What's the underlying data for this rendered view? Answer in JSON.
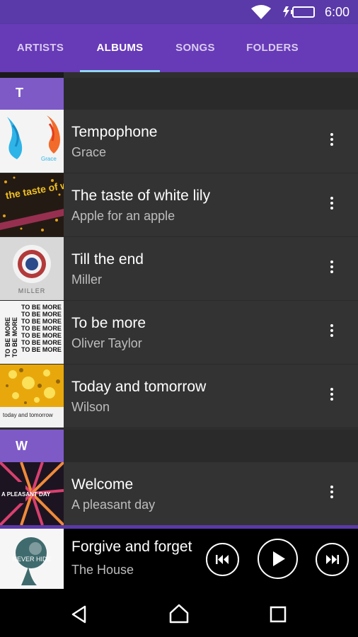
{
  "status_bar": {
    "time": "6:00"
  },
  "tabs": [
    {
      "label": "ARTISTS"
    },
    {
      "label": "ALBUMS"
    },
    {
      "label": "SONGS"
    },
    {
      "label": "FOLDERS"
    }
  ],
  "active_tab": "ALBUMS",
  "sections": [
    {
      "letter": "T",
      "albums": [
        {
          "title": "Tempophone",
          "artist": "Grace",
          "art_text": "Grace"
        },
        {
          "title": "The taste of white lily",
          "artist": "Apple for an apple",
          "art_text": "the taste of white lily"
        },
        {
          "title": "Till the end",
          "artist": "Miller",
          "art_text": "MILLER"
        },
        {
          "title": "To be more",
          "artist": "Oliver Taylor",
          "art_text": "TO BE MORE"
        },
        {
          "title": "Today and tomorrow",
          "artist": "Wilson",
          "art_text": "today and tomorrow"
        }
      ]
    },
    {
      "letter": "W",
      "albums": [
        {
          "title": "Welcome",
          "artist": "A pleasant day",
          "art_text": "A PLEASANT DAY"
        }
      ]
    }
  ],
  "now_playing": {
    "title": "Forgive and forget",
    "artist": "The House",
    "art_text": "NEVER HIDE"
  },
  "colors": {
    "accent": "#673ab7",
    "tab_indicator": "#8fd8f2",
    "section_header": "#7e5ac7"
  }
}
